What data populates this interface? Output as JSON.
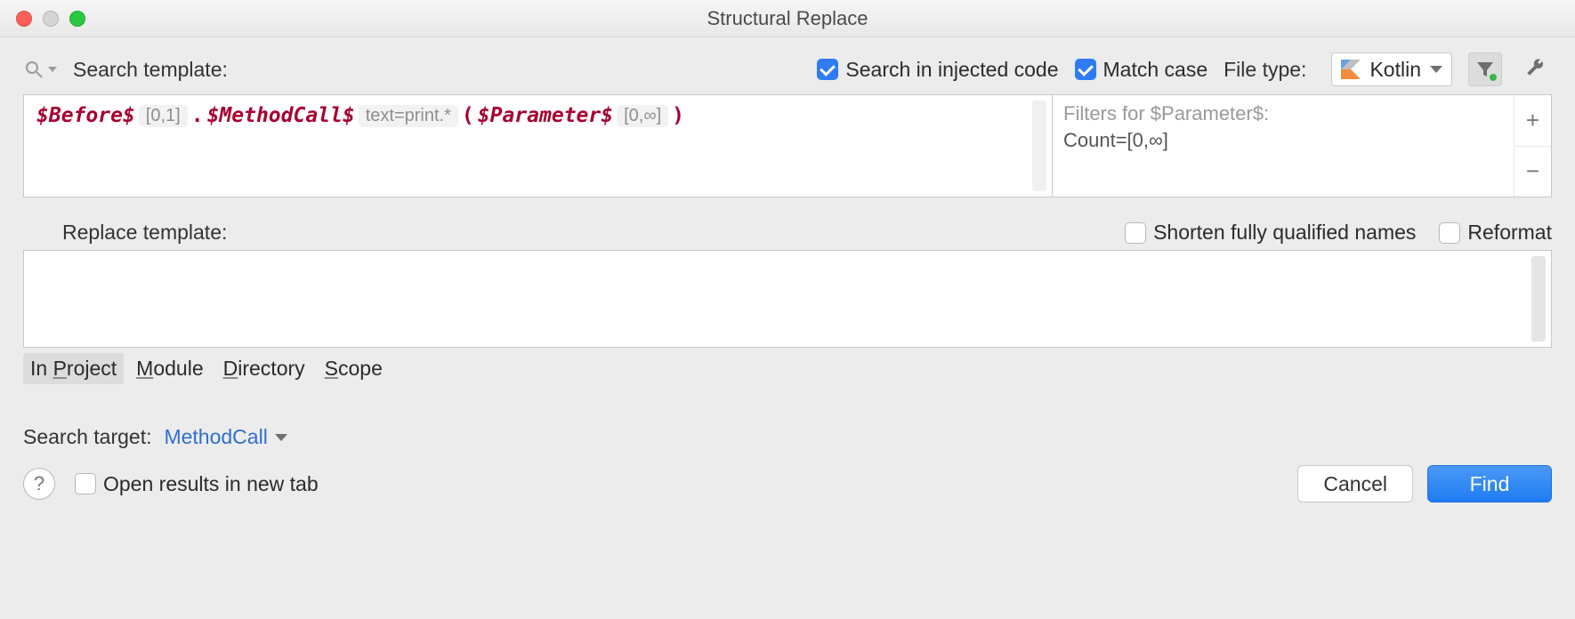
{
  "window": {
    "title": "Structural Replace"
  },
  "toprow": {
    "search_template_label": "Search template:",
    "injected_label": "Search in injected code",
    "injected_checked": true,
    "matchcase_label": "Match case",
    "matchcase_checked": true,
    "filetype_label": "File type:",
    "filetype_value": "Kotlin"
  },
  "template": {
    "var_before": "$Before$",
    "hint_before": "[0,1]",
    "dot": ".",
    "var_method": "$MethodCall$",
    "hint_method": "text=print.*",
    "lparen": "(",
    "var_param": "$Parameter$",
    "hint_param": "[0,∞]",
    "rparen": ")"
  },
  "filters": {
    "title": "Filters for $Parameter$:",
    "line1": "Count=[0,∞]",
    "add": "+",
    "remove": "−"
  },
  "replace": {
    "label": "Replace template:",
    "shorten_label": "Shorten fully qualified names",
    "shorten_checked": false,
    "reformat_label": "Reformat",
    "reformat_checked": false
  },
  "scope": {
    "tabs": [
      {
        "pre": "In ",
        "mn": "P",
        "post": "roject",
        "selected": true
      },
      {
        "pre": "",
        "mn": "M",
        "post": "odule",
        "selected": false
      },
      {
        "pre": "",
        "mn": "D",
        "post": "irectory",
        "selected": false
      },
      {
        "pre": "",
        "mn": "S",
        "post": "cope",
        "selected": false
      }
    ]
  },
  "target": {
    "label": "Search target:",
    "value": "MethodCall"
  },
  "bottom": {
    "help": "?",
    "newtab_label": "Open results in new tab",
    "newtab_checked": false,
    "cancel": "Cancel",
    "find": "Find"
  }
}
